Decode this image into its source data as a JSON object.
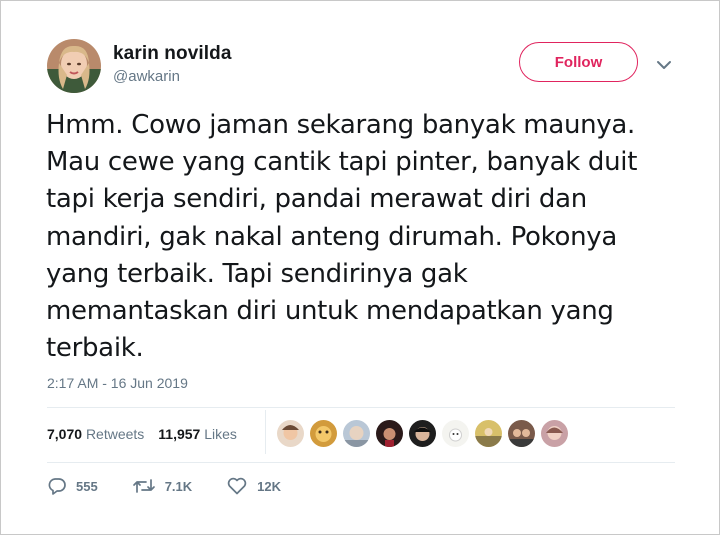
{
  "author": {
    "name": "karin novilda",
    "handle": "@awkarin"
  },
  "follow_label": "Follow",
  "tweet": {
    "lines": [
      "Hmm. Cowo jaman sekarang banyak maunya.",
      "Mau cewe yang cantik tapi pinter, banyak duit",
      "tapi kerja sendiri, pandai merawat diri dan",
      "mandiri, gak nakal anteng dirumah. Pokonya",
      "yang terbaik. Tapi sendirinya gak",
      "memantaskan diri untuk mendapatkan yang",
      "terbaik."
    ],
    "timestamp": "2:17 AM - 16 Jun 2019"
  },
  "stats": {
    "retweets_count": "7,070",
    "retweets_label": "Retweets",
    "likes_count": "11,957",
    "likes_label": "Likes"
  },
  "actions": {
    "reply_count": "555",
    "retweet_count": "7.1K",
    "like_count": "12K"
  },
  "icons": {
    "caret": "chevron-down-icon",
    "reply": "reply-icon",
    "retweet": "retweet-icon",
    "like": "heart-icon"
  },
  "colors": {
    "follow_accent": "#e0245e",
    "secondary_text": "#657786",
    "primary_text": "#14171a"
  }
}
